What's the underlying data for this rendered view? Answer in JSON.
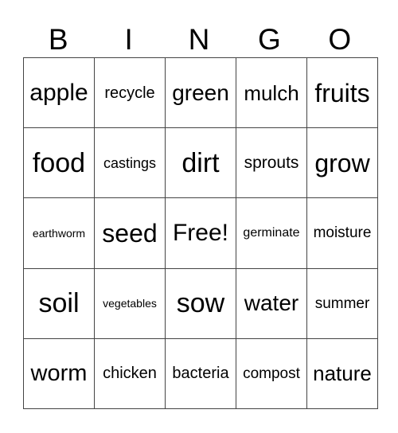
{
  "header": [
    "B",
    "I",
    "N",
    "G",
    "O"
  ],
  "cells": [
    [
      {
        "text": "apple",
        "size": 30
      },
      {
        "text": "recycle",
        "size": 20
      },
      {
        "text": "green",
        "size": 28
      },
      {
        "text": "mulch",
        "size": 26
      },
      {
        "text": "fruits",
        "size": 32
      }
    ],
    [
      {
        "text": "food",
        "size": 34
      },
      {
        "text": "castings",
        "size": 18
      },
      {
        "text": "dirt",
        "size": 34
      },
      {
        "text": "sprouts",
        "size": 21
      },
      {
        "text": "grow",
        "size": 32
      }
    ],
    [
      {
        "text": "earthworm",
        "size": 14
      },
      {
        "text": "seed",
        "size": 32
      },
      {
        "text": "Free!",
        "size": 30
      },
      {
        "text": "germinate",
        "size": 16
      },
      {
        "text": "moisture",
        "size": 19
      }
    ],
    [
      {
        "text": "soil",
        "size": 34
      },
      {
        "text": "vegetables",
        "size": 14
      },
      {
        "text": "sow",
        "size": 34
      },
      {
        "text": "water",
        "size": 28
      },
      {
        "text": "summer",
        "size": 19
      }
    ],
    [
      {
        "text": "worm",
        "size": 29
      },
      {
        "text": "chicken",
        "size": 20
      },
      {
        "text": "bacteria",
        "size": 20
      },
      {
        "text": "compost",
        "size": 19
      },
      {
        "text": "nature",
        "size": 26
      }
    ]
  ]
}
